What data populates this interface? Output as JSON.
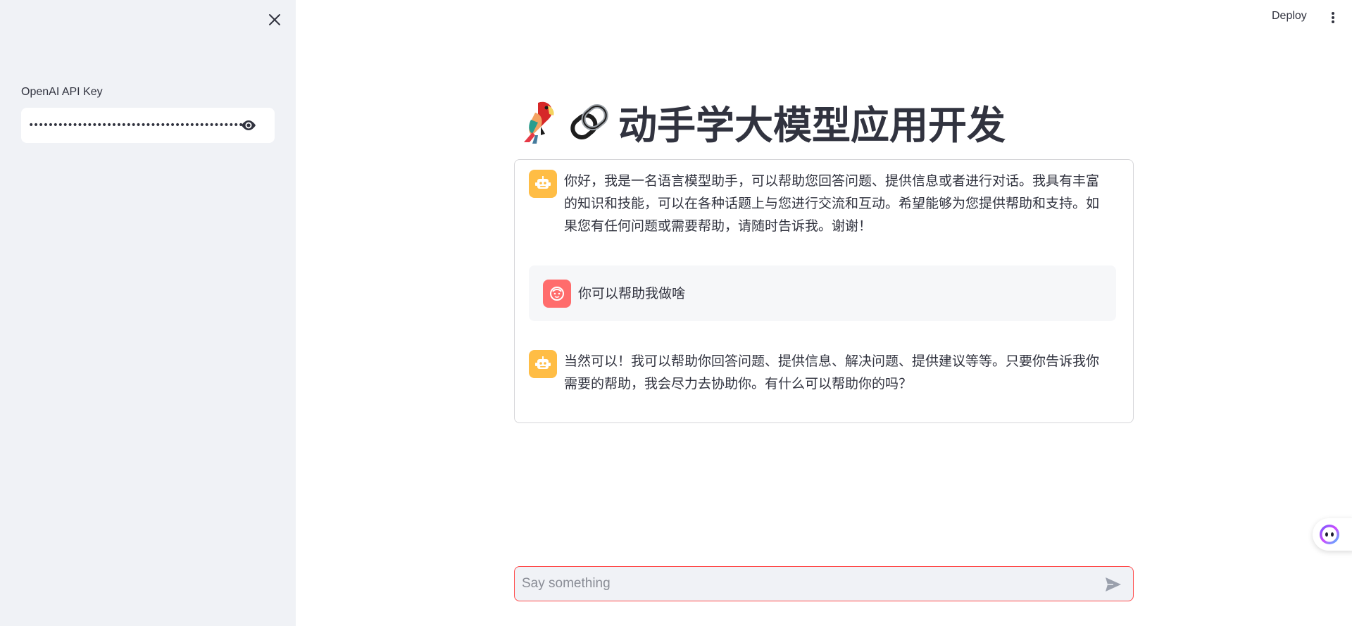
{
  "sidebar": {
    "api_key_label": "OpenAI API Key",
    "api_key_value": "••••••••••••••••••••••••••••••••••••••••••••••••••",
    "icons": {
      "close": "close-icon",
      "reveal": "eye-icon"
    }
  },
  "header": {
    "deploy_label": "Deploy",
    "menu_icon": "kebab-menu-icon"
  },
  "main": {
    "title": "动手学大模型应用开发",
    "title_emojis": [
      "parrot",
      "link"
    ],
    "messages": [
      {
        "role": "assistant",
        "text": "你好，我是一名语言模型助手，可以帮助您回答问题、提供信息或者进行对话。我具有丰富的知识和技能，可以在各种话题上与您进行交流和互动。希望能够为您提供帮助和支持。如果您有任何问题或需要帮助，请随时告诉我。谢谢！"
      },
      {
        "role": "user",
        "text": "你可以帮助我做啥"
      },
      {
        "role": "assistant",
        "text": "当然可以！我可以帮助你回答问题、提供信息、解决问题、提供建议等等。只要你告诉我你需要的帮助，我会尽力去协助你。有什么可以帮助你的吗？"
      }
    ]
  },
  "chat_input": {
    "placeholder": "Say something",
    "send_icon": "send-icon"
  },
  "colors": {
    "sidebar_bg": "#f0f2f6",
    "bot_avatar": "#ffbd45",
    "user_avatar": "#ff6c6c",
    "input_border": "#ff4b4b",
    "text": "#31333f"
  }
}
